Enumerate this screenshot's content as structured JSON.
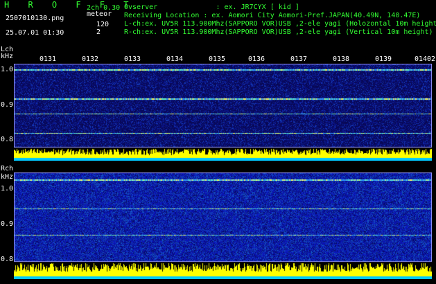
{
  "header": {
    "title": "H R O F F T",
    "channel": "2ch 0.30",
    "filename": "2507010130.png",
    "mode": "meteor",
    "count_primary": "120",
    "count_secondary": "2",
    "datetime": "25.07.01 01:30",
    "observer": "Ovserver              : ex. JR7CYX [ kid ]",
    "location": "Receiving Location : ex. Aomori City Aomori-Pref.JAPAN(40.49N, 140.47E)",
    "lch_info": "L-ch:ex. UV5R 113.900Mhz(SAPPORO VOR)USB ,2-ele yagi (Holozontal 10m height)",
    "rch_info": "R-ch:ex. UV5R 113.900Mhz(SAPPORO VOR)USB ,2-ele yagi (Vertical 10m height)"
  },
  "lch_panel": {
    "label": "Lch",
    "unit": "kHz",
    "y_ticks": [
      "1.0",
      "0.9",
      "0.8"
    ],
    "time_labels": [
      "0131",
      "0132",
      "0133",
      "0134",
      "0135",
      "0136",
      "0137",
      "0138",
      "0139",
      "0140"
    ],
    "edge_label": "2"
  },
  "rch_panel": {
    "label": "Rch",
    "unit": "kHz",
    "y_ticks": [
      "1.0",
      "0.9",
      "0.8"
    ]
  },
  "colors": {
    "background": "#000000",
    "header_green": "#33ff33",
    "spectrum_low": "#0a0a5a",
    "spectrum_mid": "#3aa0ff",
    "signal_high": "#ffff00",
    "level_bar": "#ffff00",
    "level_base": "#00c8ff"
  }
}
